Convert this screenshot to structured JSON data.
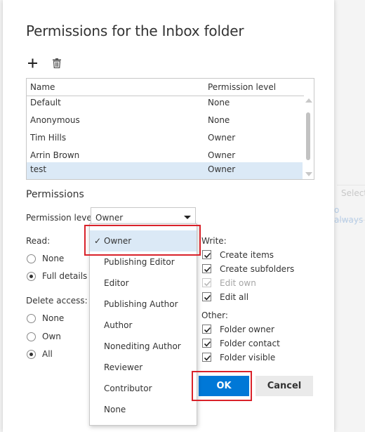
{
  "background": {
    "fragments": [
      "Select",
      "o always"
    ]
  },
  "dialog": {
    "title": "Permissions for the Inbox folder"
  },
  "toolbar": {
    "add_icon": "plus-icon",
    "delete_icon": "trash-icon"
  },
  "table": {
    "columns": [
      "Name",
      "Permission level"
    ],
    "rows": [
      {
        "name": "Default",
        "level": "None"
      },
      {
        "name": "Anonymous",
        "level": "None"
      },
      {
        "name": "Tim Hills",
        "level": "Owner"
      },
      {
        "name": "Arrin Brown",
        "level": "Owner"
      },
      {
        "name": "test",
        "level": "Owner"
      }
    ],
    "selected_row": "test"
  },
  "permissions": {
    "title": "Permissions",
    "level_label": "Permission level:",
    "level_value": "Owner",
    "read": {
      "label": "Read:",
      "options": [
        "None",
        "Full details"
      ],
      "selected": "Full details"
    },
    "delete_access": {
      "label": "Delete access:",
      "options": [
        "None",
        "Own",
        "All"
      ],
      "selected": "All"
    },
    "write": {
      "label": "Write:",
      "items": [
        {
          "label": "Create items",
          "checked": true,
          "disabled": false
        },
        {
          "label": "Create subfolders",
          "checked": true,
          "disabled": false
        },
        {
          "label": "Edit own",
          "checked": true,
          "disabled": true
        },
        {
          "label": "Edit all",
          "checked": true,
          "disabled": false
        }
      ]
    },
    "other": {
      "label": "Other:",
      "items": [
        {
          "label": "Folder owner",
          "checked": true
        },
        {
          "label": "Folder contact",
          "checked": true
        },
        {
          "label": "Folder visible",
          "checked": true
        }
      ]
    }
  },
  "dropdown": {
    "options": [
      "Owner",
      "Publishing Editor",
      "Editor",
      "Publishing Author",
      "Author",
      "Nonediting Author",
      "Reviewer",
      "Contributor",
      "None"
    ],
    "selected": "Owner",
    "check_glyph": "✓"
  },
  "buttons": {
    "ok": "OK",
    "cancel": "Cancel"
  },
  "colors": {
    "accent": "#0078d7",
    "selection": "#dbe9f6",
    "highlight": "#d9222a"
  }
}
